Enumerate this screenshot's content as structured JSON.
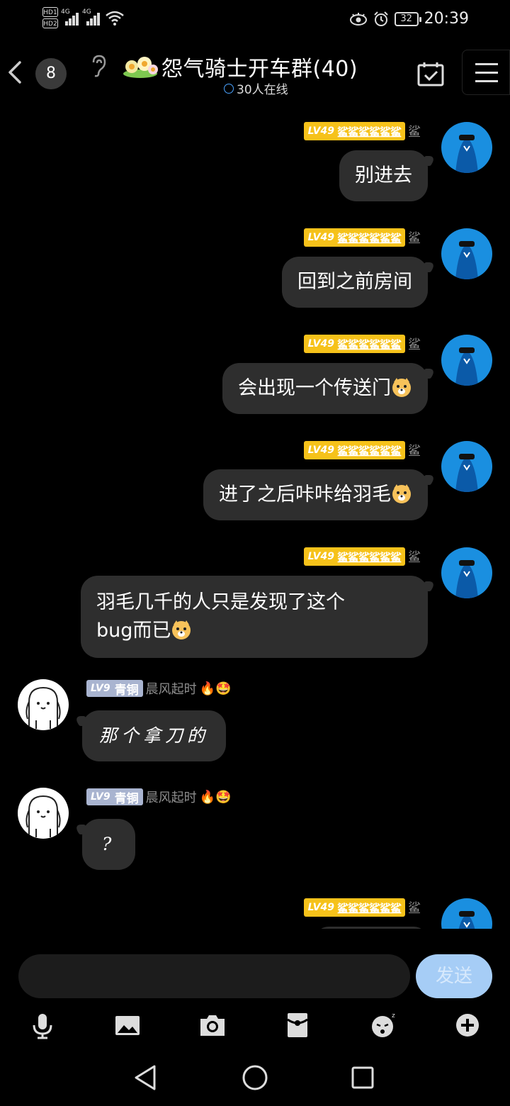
{
  "status_bar": {
    "hd1": "HD1",
    "hd2": "HD2",
    "net1": "4G",
    "net2": "4G",
    "battery": "32",
    "time": "20:39"
  },
  "header": {
    "unread_count": "8",
    "group_title": "怨气骑士开车群(40)",
    "online_text": "30人在线"
  },
  "messages": [
    {
      "side": "right",
      "level": "LV49",
      "title": "鲨鲨鲨鲨鲨鲨",
      "nick": "鲨",
      "text": "别进去"
    },
    {
      "side": "right",
      "level": "LV49",
      "title": "鲨鲨鲨鲨鲨鲨",
      "nick": "鲨",
      "text": "回到之前房间"
    },
    {
      "side": "right",
      "level": "LV49",
      "title": "鲨鲨鲨鲨鲨鲨",
      "nick": "鲨",
      "text": "会出现一个传送门"
    },
    {
      "side": "right",
      "level": "LV49",
      "title": "鲨鲨鲨鲨鲨鲨",
      "nick": "鲨",
      "text": "进了之后咔咔给羽毛"
    },
    {
      "side": "right",
      "level": "LV49",
      "title": "鲨鲨鲨鲨鲨鲨",
      "nick": "鲨",
      "line1": "羽毛几千的人只是发现了这个",
      "line2": "bug而已"
    },
    {
      "side": "left",
      "level": "LV9",
      "title": "青铜",
      "nick": "晨风起时",
      "emoji": "🔥🤩",
      "text": "那个拿刀的"
    },
    {
      "side": "left",
      "level": "LV9",
      "title": "青铜",
      "nick": "晨风起时",
      "emoji": "🔥🤩",
      "text": "?"
    },
    {
      "side": "right",
      "level": "LV49",
      "title": "鲨鲨鲨鲨鲨鲨",
      "nick": "鲨"
    }
  ],
  "input": {
    "value": "",
    "send_label": "发送"
  },
  "colors": {
    "background": "#000000",
    "bubble": "#2e2e2e",
    "gold_badge": "#f6c21a",
    "silver_badge": "#a9b4d0",
    "send_button": "#a6cdf6",
    "shark_avatar": "#1a8fe0"
  },
  "icons": {
    "toolbar": [
      "microphone-icon",
      "image-icon",
      "camera-icon",
      "red-packet-icon",
      "sticker-icon",
      "plus-icon"
    ],
    "nav": [
      "nav-back-icon",
      "nav-home-icon",
      "nav-recent-icon"
    ]
  }
}
